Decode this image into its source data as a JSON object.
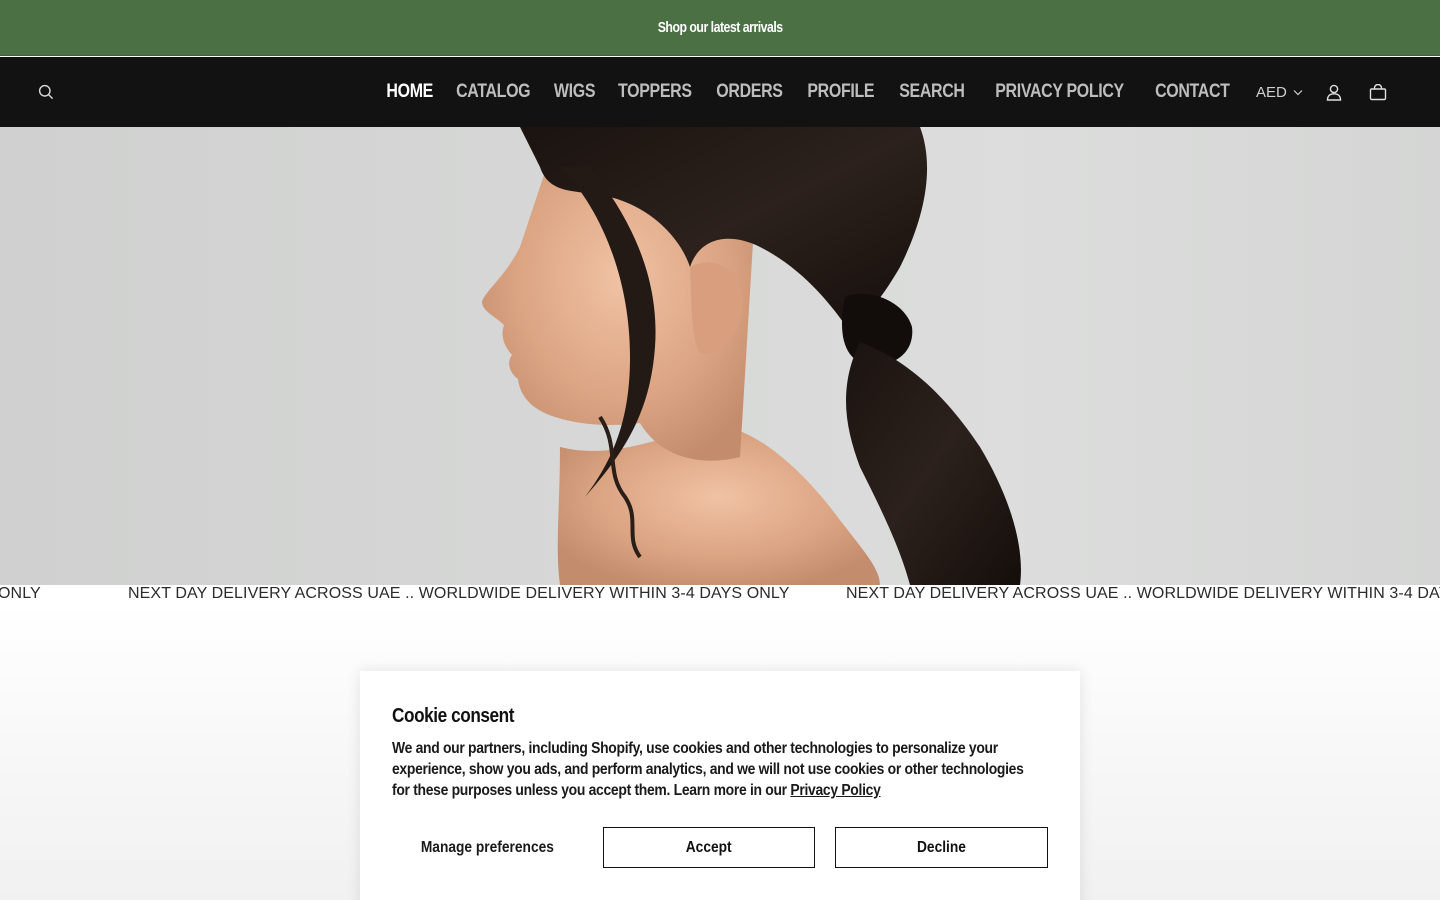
{
  "announcement": {
    "text": "Shop our latest arrivals"
  },
  "header": {
    "nav": [
      {
        "label": "HOME",
        "active": true
      },
      {
        "label": "CATALOG"
      },
      {
        "label": "WIGS"
      },
      {
        "label": "TOPPERS"
      },
      {
        "label": "ORDERS"
      },
      {
        "label": "PROFILE"
      },
      {
        "label": "SEARCH"
      },
      {
        "label": "PRIVACY POLICY"
      },
      {
        "label": "CONTACT"
      }
    ],
    "currency": "AED",
    "icons": [
      "search-icon",
      "chevron-down-icon",
      "account-icon",
      "cart-icon"
    ]
  },
  "marquee": {
    "fragment": "ONLY",
    "text": "NEXT DAY DELIVERY ACROSS UAE .. WORLDWIDE DELIVERY WITHIN 3-4 DAYS ONLY",
    "text_cut": "NEXT DAY DELIVERY ACROSS UAE .. WORLDWIDE DELIVERY WITHIN 3-4 DAYS O"
  },
  "cookie": {
    "title": "Cookie consent",
    "body": "We and our partners, including Shopify, use cookies and other technologies to personalize your experience, show you ads, and perform analytics, and we will not use cookies or other technologies for these purposes unless you accept them. Learn more in our ",
    "link": "Privacy Policy",
    "manage_label": "Manage preferences",
    "accept_label": "Accept",
    "decline_label": "Decline"
  },
  "colors": {
    "announcement_bg": "#4a7044",
    "header_bg": "#121212",
    "nav_active": "#ffffff",
    "nav_inactive": "#bdbdbd"
  }
}
